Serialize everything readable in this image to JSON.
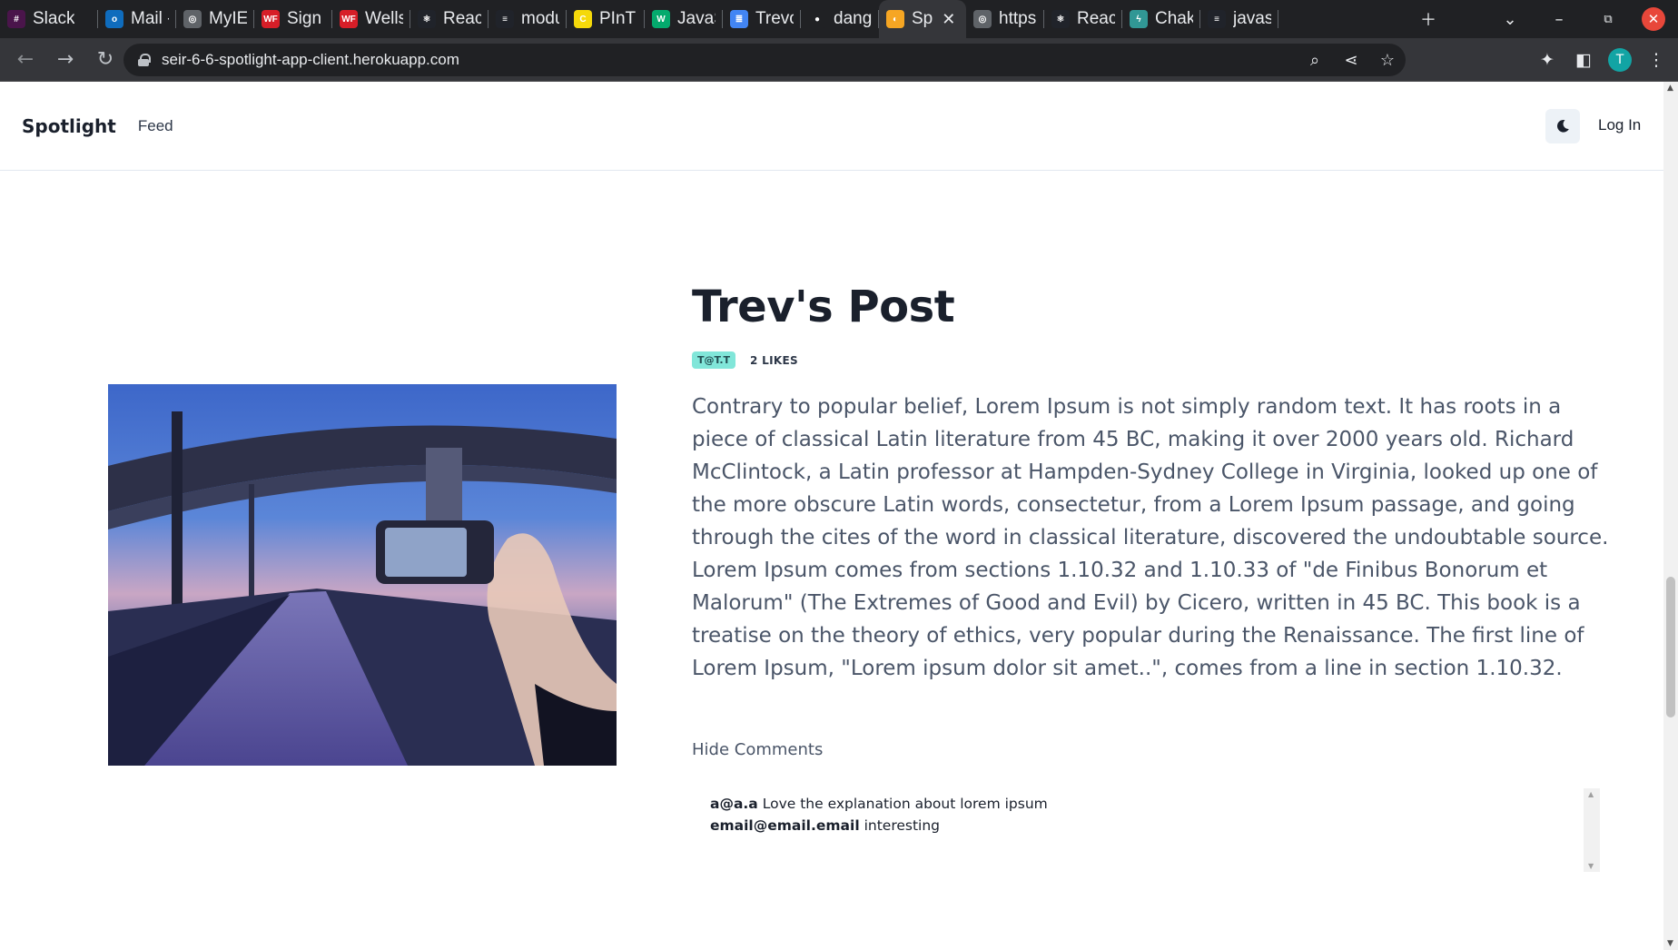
{
  "browser": {
    "tabs": [
      {
        "label": "Slack",
        "icon": "slack-icon",
        "color": "#4a154b",
        "glyph": "#"
      },
      {
        "label": "Mail -",
        "icon": "outlook-mail-icon",
        "color": "#0f6cbd",
        "glyph": "o"
      },
      {
        "label": "MyIES",
        "icon": "globe-icon",
        "color": "#5f6368",
        "glyph": "◎"
      },
      {
        "label": "Sign (",
        "icon": "wells-fargo-icon",
        "color": "#d71e28",
        "glyph": "WF"
      },
      {
        "label": "Wells",
        "icon": "wells-fargo-icon",
        "color": "#d71e28",
        "glyph": "WF"
      },
      {
        "label": "React",
        "icon": "react-icon",
        "color": "#20232a",
        "glyph": "⚛"
      },
      {
        "label": "modu",
        "icon": "stackoverflow-icon",
        "color": "#20232a",
        "glyph": "≡"
      },
      {
        "label": "PInT",
        "icon": "pint-icon",
        "color": "#f5d90a",
        "glyph": "C"
      },
      {
        "label": "JavaS",
        "icon": "w3schools-icon",
        "color": "#04aa6d",
        "glyph": "W"
      },
      {
        "label": "Trevo",
        "icon": "google-docs-icon",
        "color": "#4285f4",
        "glyph": "≣"
      },
      {
        "label": "dang",
        "icon": "github-icon",
        "color": "#202124",
        "glyph": "●"
      },
      {
        "label": "Sp",
        "icon": "spotlight-icon",
        "color": "#f6a623",
        "glyph": "◐",
        "active": true
      },
      {
        "label": "https",
        "icon": "globe-icon",
        "color": "#5f6368",
        "glyph": "◎"
      },
      {
        "label": "React",
        "icon": "react-icon",
        "color": "#20232a",
        "glyph": "⚛"
      },
      {
        "label": "Chak",
        "icon": "chakra-icon",
        "color": "#319795",
        "glyph": "ϟ"
      },
      {
        "label": "javas",
        "icon": "stackoverflow-icon",
        "color": "#20232a",
        "glyph": "≡"
      }
    ],
    "url": "seir-6-6-spotlight-app-client.herokuapp.com",
    "profile_initial": "T"
  },
  "navbar": {
    "brand": "Spotlight",
    "feed_link": "Feed",
    "login_link": "Log In"
  },
  "post": {
    "title": "Trev's Post",
    "author_badge": "T@T.T",
    "likes": "2 LIKES",
    "image_description_icon": "photo-icon",
    "body": "Contrary to popular belief, Lorem Ipsum is not simply random text. It has roots in a piece of classical Latin literature from 45 BC, making it over 2000 years old. Richard McClintock, a Latin professor at Hampden-Sydney College in Virginia, looked up one of the more obscure Latin words, consectetur, from a Lorem Ipsum passage, and going through the cites of the word in classical literature, discovered the undoubtable source. Lorem Ipsum comes from sections 1.10.32 and 1.10.33 of \"de Finibus Bonorum et Malorum\" (The Extremes of Good and Evil) by Cicero, written in 45 BC. This book is a treatise on the theory of ethics, very popular during the Renaissance. The first line of Lorem Ipsum, \"Lorem ipsum dolor sit amet..\", comes from a line in section 1.10.32.",
    "toggle_comments": "Hide Comments"
  },
  "comments": [
    {
      "user": "a@a.a",
      "text": "Love the explanation about lorem ipsum"
    },
    {
      "user": "email@email.email",
      "text": "interesting"
    }
  ],
  "colors": {
    "accent_badge": "#81e6d9",
    "title": "#1a202c",
    "body": "#4a5568"
  }
}
